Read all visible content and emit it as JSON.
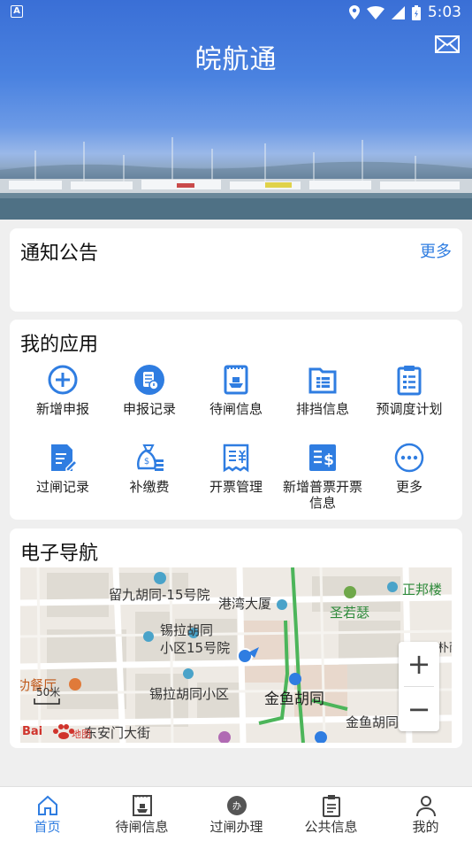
{
  "status": {
    "time": "5:03"
  },
  "header": {
    "title": "皖航通"
  },
  "notice": {
    "title": "通知公告",
    "more": "更多"
  },
  "apps": {
    "title": "我的应用",
    "items": [
      {
        "label": "新增申报",
        "icon": "plus-circle-icon"
      },
      {
        "label": "申报记录",
        "icon": "record-icon"
      },
      {
        "label": "待闸信息",
        "icon": "ship-ticket-icon"
      },
      {
        "label": "排挡信息",
        "icon": "folder-list-icon"
      },
      {
        "label": "预调度计划",
        "icon": "clipboard-icon"
      },
      {
        "label": "过闸记录",
        "icon": "edit-doc-icon"
      },
      {
        "label": "补缴费",
        "icon": "money-bag-icon"
      },
      {
        "label": "开票管理",
        "icon": "invoice-icon"
      },
      {
        "label": "新增普票开票信息",
        "icon": "invoice-dollar-icon"
      },
      {
        "label": "更多",
        "icon": "more-dots-icon"
      }
    ]
  },
  "navigation": {
    "title": "电子导航",
    "map_labels": {
      "l1": "留九胡同-15号院",
      "l2": "港湾大厦",
      "l3": "圣若瑟",
      "l4": "正邦楼",
      "l5": "锡拉胡同",
      "l6": "小区15号院",
      "l7": "功餐厅",
      "l8": "锡拉胡同小区",
      "l9": "金鱼胡同",
      "l10": "金鱼胡同",
      "l11": "东安门大街",
      "l12": "朴雨",
      "scale": "50米",
      "baidu": "Bai",
      "baidu2": "地图"
    },
    "zoom_in": "+",
    "zoom_out": "−"
  },
  "tabs": [
    {
      "label": "首页",
      "icon": "home-icon",
      "active": true
    },
    {
      "label": "待闸信息",
      "icon": "ship-ticket-icon"
    },
    {
      "label": "过闸办理",
      "icon": "process-icon"
    },
    {
      "label": "公共信息",
      "icon": "clipboard-icon"
    },
    {
      "label": "我的",
      "icon": "user-icon"
    }
  ]
}
